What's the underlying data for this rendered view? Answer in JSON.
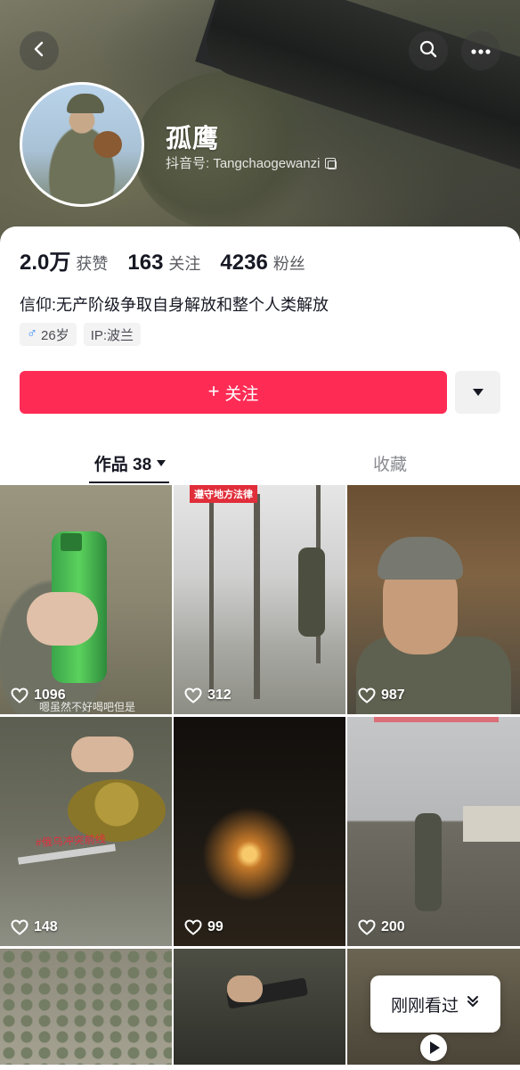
{
  "profile": {
    "nickname": "孤鹰",
    "douyin_id": "抖音号: Tangchaogewanzi",
    "bio": "信仰:无产阶级争取自身解放和整个人类解放",
    "tags": [
      {
        "icon": "male-icon",
        "text": "26岁"
      },
      {
        "icon": "",
        "text": "IP:波兰"
      }
    ]
  },
  "stats": [
    {
      "num": "2.0万",
      "label": "获赞"
    },
    {
      "num": "163",
      "label": "关注"
    },
    {
      "num": "4236",
      "label": "粉丝"
    }
  ],
  "actions": {
    "follow_label": "关注",
    "follow_color": "#fe2c55"
  },
  "tabs": {
    "works_label": "作品 38",
    "favorites_label": "收藏"
  },
  "videos": [
    {
      "likes": "1096",
      "caption": "嗯虽然不好喝吧但是"
    },
    {
      "likes": "312",
      "badge": "遵守地方法律"
    },
    {
      "likes": "987"
    },
    {
      "likes": "148",
      "overlay_text": "#俄乌冲突前线"
    },
    {
      "likes": "99"
    },
    {
      "likes": "200"
    },
    {
      "likes": ""
    },
    {
      "likes": ""
    },
    {
      "likes": ""
    }
  ],
  "floating": {
    "recent_label": "刚刚看过"
  },
  "icons": {
    "back": "chevron-left-icon",
    "search": "search-icon",
    "more": "ellipsis-icon",
    "heart": "heart-outline-icon",
    "copy": "copy-icon",
    "play": "play-icon"
  }
}
